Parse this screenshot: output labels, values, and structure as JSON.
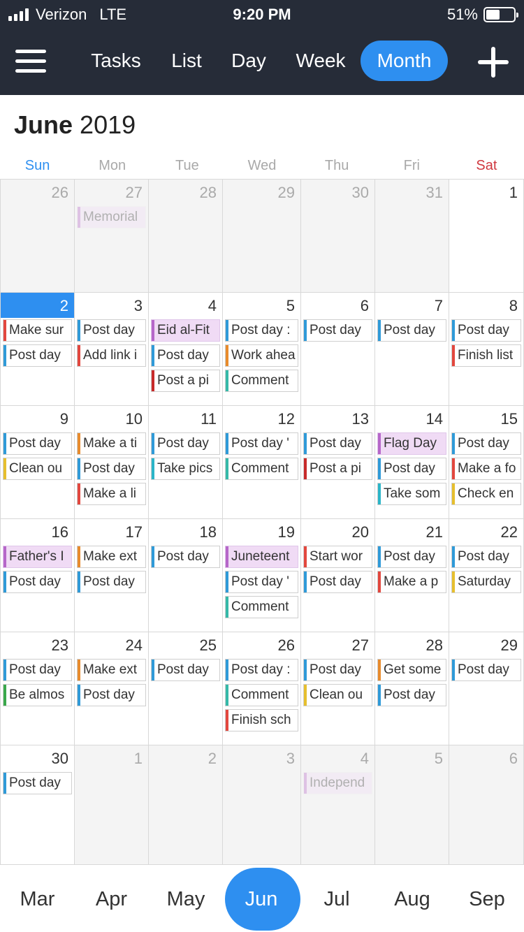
{
  "status": {
    "carrier": "Verizon",
    "network": "LTE",
    "time": "9:20 PM",
    "battery": "51%",
    "battery_level": 0.51
  },
  "nav": {
    "tabs": [
      "Tasks",
      "List",
      "Day",
      "Week",
      "Month"
    ],
    "active": "Month"
  },
  "header": {
    "month": "June",
    "year": "2019"
  },
  "weekdays": [
    "Sun",
    "Mon",
    "Tue",
    "Wed",
    "Thu",
    "Fri",
    "Sat"
  ],
  "colors": {
    "accent": "#2e8ff0",
    "sunday": "#2e8ff0",
    "saturday": "#d0383f",
    "blue": "#2f9ad8",
    "red": "#e2473e",
    "purple": "#b667c9",
    "orange": "#e88b2c",
    "teal": "#35b9a8",
    "yellow": "#e6bf2e",
    "green": "#3aa84b",
    "darkred": "#c72a2a",
    "cyan": "#2bb5c8"
  },
  "weeks": [
    [
      {
        "day": "26",
        "other": true,
        "events": []
      },
      {
        "day": "27",
        "other": true,
        "events": [
          {
            "t": "Memorial",
            "c": "purple",
            "faded": true
          }
        ]
      },
      {
        "day": "28",
        "other": true,
        "events": []
      },
      {
        "day": "29",
        "other": true,
        "events": []
      },
      {
        "day": "30",
        "other": true,
        "events": []
      },
      {
        "day": "31",
        "other": true,
        "events": []
      },
      {
        "day": "1",
        "events": []
      }
    ],
    [
      {
        "day": "2",
        "today": true,
        "events": [
          {
            "t": "Make sur",
            "c": "red"
          },
          {
            "t": "Post day",
            "c": "blue"
          }
        ]
      },
      {
        "day": "3",
        "events": [
          {
            "t": "Post day",
            "c": "blue"
          },
          {
            "t": "Add link i",
            "c": "red"
          }
        ]
      },
      {
        "day": "4",
        "events": [
          {
            "t": "Eid al-Fit",
            "c": "purple",
            "hol": true
          },
          {
            "t": "Post day",
            "c": "blue"
          },
          {
            "t": "Post a pi",
            "c": "darkred"
          }
        ]
      },
      {
        "day": "5",
        "events": [
          {
            "t": "Post day :",
            "c": "blue"
          },
          {
            "t": "Work ahea",
            "c": "orange"
          },
          {
            "t": "Comment",
            "c": "teal"
          }
        ]
      },
      {
        "day": "6",
        "events": [
          {
            "t": "Post day",
            "c": "blue"
          }
        ]
      },
      {
        "day": "7",
        "events": [
          {
            "t": "Post day",
            "c": "blue"
          }
        ]
      },
      {
        "day": "8",
        "events": [
          {
            "t": "Post day",
            "c": "blue"
          },
          {
            "t": "Finish list",
            "c": "red"
          }
        ]
      }
    ],
    [
      {
        "day": "9",
        "events": [
          {
            "t": "Post day",
            "c": "blue"
          },
          {
            "t": "Clean ou",
            "c": "yellow"
          }
        ]
      },
      {
        "day": "10",
        "events": [
          {
            "t": "Make a ti",
            "c": "orange"
          },
          {
            "t": "Post day",
            "c": "blue"
          },
          {
            "t": "Make a li",
            "c": "red"
          }
        ]
      },
      {
        "day": "11",
        "events": [
          {
            "t": "Post day",
            "c": "blue"
          },
          {
            "t": "Take pics",
            "c": "cyan"
          }
        ]
      },
      {
        "day": "12",
        "events": [
          {
            "t": "Post day '",
            "c": "blue"
          },
          {
            "t": "Comment",
            "c": "teal"
          }
        ]
      },
      {
        "day": "13",
        "events": [
          {
            "t": "Post day",
            "c": "blue"
          },
          {
            "t": "Post a pi",
            "c": "darkred"
          }
        ]
      },
      {
        "day": "14",
        "events": [
          {
            "t": "Flag Day",
            "c": "purple",
            "hol": true
          },
          {
            "t": "Post day",
            "c": "blue"
          },
          {
            "t": "Take som",
            "c": "cyan"
          }
        ]
      },
      {
        "day": "15",
        "events": [
          {
            "t": "Post day",
            "c": "blue"
          },
          {
            "t": "Make a fo",
            "c": "red"
          },
          {
            "t": "Check en",
            "c": "yellow"
          }
        ]
      }
    ],
    [
      {
        "day": "16",
        "events": [
          {
            "t": "Father's I",
            "c": "purple",
            "hol": true
          },
          {
            "t": "Post day",
            "c": "blue"
          }
        ]
      },
      {
        "day": "17",
        "events": [
          {
            "t": "Make ext",
            "c": "orange"
          },
          {
            "t": "Post day",
            "c": "blue"
          }
        ]
      },
      {
        "day": "18",
        "events": [
          {
            "t": "Post day",
            "c": "blue"
          }
        ]
      },
      {
        "day": "19",
        "events": [
          {
            "t": "Juneteent",
            "c": "purple",
            "hol": true
          },
          {
            "t": "Post day '",
            "c": "blue"
          },
          {
            "t": "Comment",
            "c": "teal"
          }
        ]
      },
      {
        "day": "20",
        "events": [
          {
            "t": "Start wor",
            "c": "red"
          },
          {
            "t": "Post day",
            "c": "blue"
          }
        ]
      },
      {
        "day": "21",
        "events": [
          {
            "t": "Post day",
            "c": "blue"
          },
          {
            "t": "Make a p",
            "c": "red"
          }
        ]
      },
      {
        "day": "22",
        "events": [
          {
            "t": "Post day",
            "c": "blue"
          },
          {
            "t": "Saturday",
            "c": "yellow"
          }
        ]
      }
    ],
    [
      {
        "day": "23",
        "events": [
          {
            "t": "Post day",
            "c": "blue"
          },
          {
            "t": "Be almos",
            "c": "green"
          }
        ]
      },
      {
        "day": "24",
        "events": [
          {
            "t": "Make ext",
            "c": "orange"
          },
          {
            "t": "Post day",
            "c": "blue"
          }
        ]
      },
      {
        "day": "25",
        "events": [
          {
            "t": "Post day",
            "c": "blue"
          }
        ]
      },
      {
        "day": "26",
        "events": [
          {
            "t": "Post day :",
            "c": "blue"
          },
          {
            "t": "Comment",
            "c": "teal"
          },
          {
            "t": "Finish sch",
            "c": "red"
          }
        ]
      },
      {
        "day": "27",
        "events": [
          {
            "t": "Post day",
            "c": "blue"
          },
          {
            "t": "Clean ou",
            "c": "yellow"
          }
        ]
      },
      {
        "day": "28",
        "events": [
          {
            "t": "Get some",
            "c": "orange"
          },
          {
            "t": "Post day",
            "c": "blue"
          }
        ]
      },
      {
        "day": "29",
        "events": [
          {
            "t": "Post day",
            "c": "blue"
          }
        ]
      }
    ],
    [
      {
        "day": "30",
        "events": [
          {
            "t": "Post day",
            "c": "blue"
          }
        ]
      },
      {
        "day": "1",
        "other": true,
        "events": []
      },
      {
        "day": "2",
        "other": true,
        "events": []
      },
      {
        "day": "3",
        "other": true,
        "events": []
      },
      {
        "day": "4",
        "other": true,
        "events": [
          {
            "t": "Independ",
            "c": "purple",
            "faded": true
          }
        ]
      },
      {
        "day": "5",
        "other": true,
        "events": []
      },
      {
        "day": "6",
        "other": true,
        "events": []
      }
    ]
  ],
  "months": [
    "Mar",
    "Apr",
    "May",
    "Jun",
    "Jul",
    "Aug",
    "Sep"
  ],
  "active_month": "Jun"
}
